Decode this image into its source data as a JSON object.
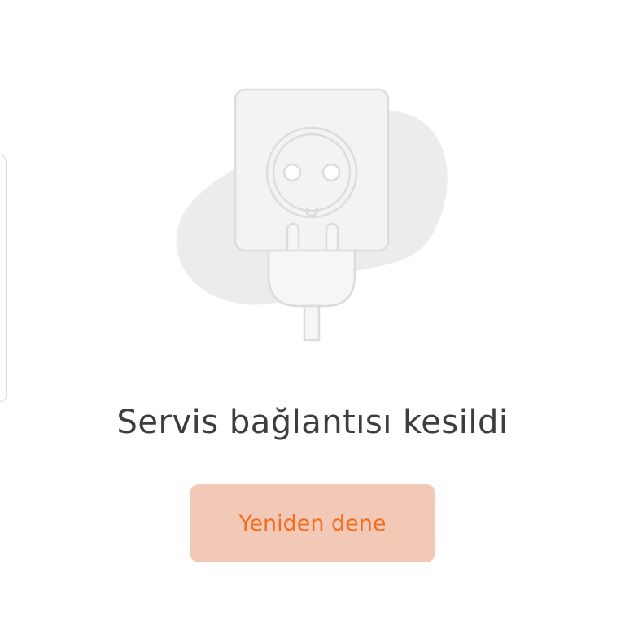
{
  "error": {
    "message": "Servis bağlantısı kesildi",
    "illustration_icon": "unplugged-socket-icon"
  },
  "actions": {
    "retry_label": "Yeniden dene"
  },
  "colors": {
    "background": "#ffffff",
    "text": "#3d3d3d",
    "button_bg": "#f1c9b6",
    "button_text": "#f36d1f",
    "illustration_blob": "#ececec",
    "illustration_stroke": "#dcdcdc"
  }
}
